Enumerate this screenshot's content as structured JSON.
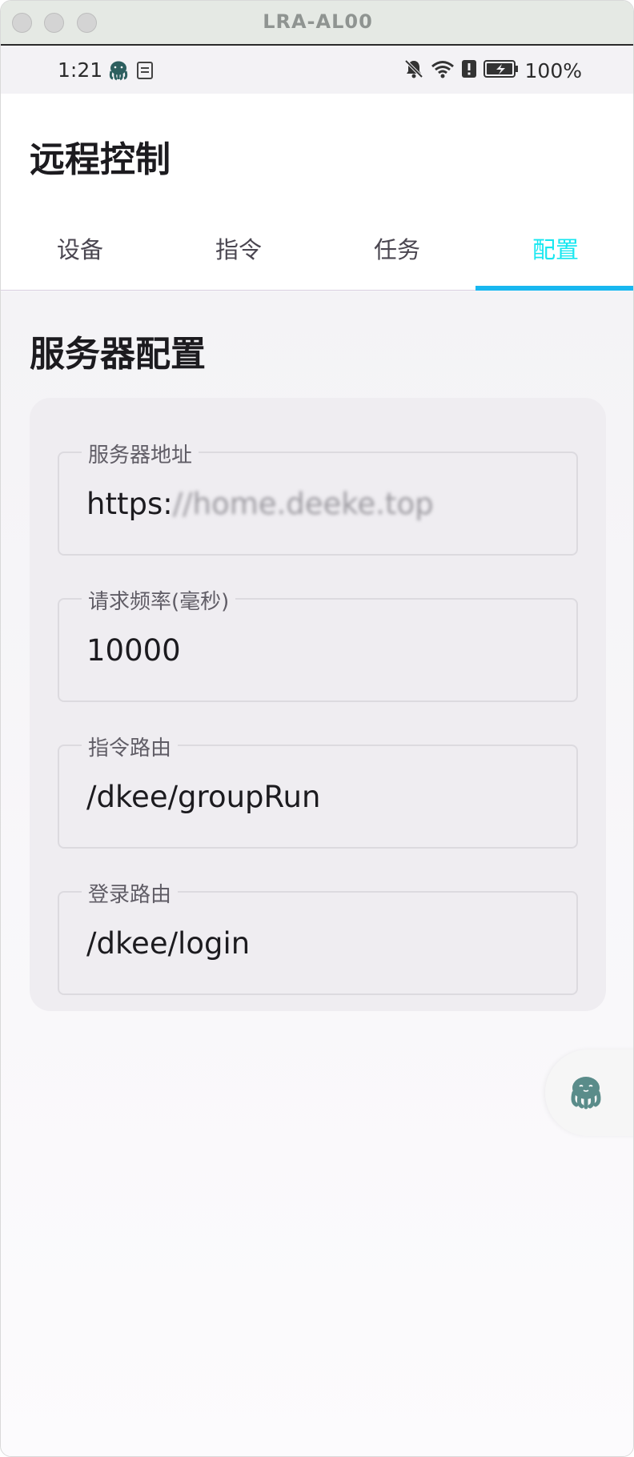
{
  "window": {
    "title": "LRA-AL00"
  },
  "status_bar": {
    "time": "1:21",
    "battery_percent": "100%"
  },
  "app": {
    "title": "远程控制"
  },
  "tabs": [
    {
      "label": "设备",
      "active": false
    },
    {
      "label": "指令",
      "active": false
    },
    {
      "label": "任务",
      "active": false
    },
    {
      "label": "配置",
      "active": true
    }
  ],
  "section": {
    "title": "服务器配置"
  },
  "fields": [
    {
      "label": "服务器地址",
      "value_prefix": "https:",
      "value_obscured": "//home.deeke.top"
    },
    {
      "label": "请求频率(毫秒)",
      "value": "10000"
    },
    {
      "label": "指令路由",
      "value": "/dkee/groupRun"
    },
    {
      "label": "登录路由",
      "value": "/dkee/login"
    }
  ],
  "colors": {
    "accent_tab_text": "#18e7f0",
    "tab_indicator": "#18b7f0",
    "card_bg": "#efedf1"
  },
  "icons": [
    "octopus-icon",
    "sim-icon",
    "mute-bell-icon",
    "wifi-icon",
    "alert-icon",
    "battery-charging-icon"
  ]
}
